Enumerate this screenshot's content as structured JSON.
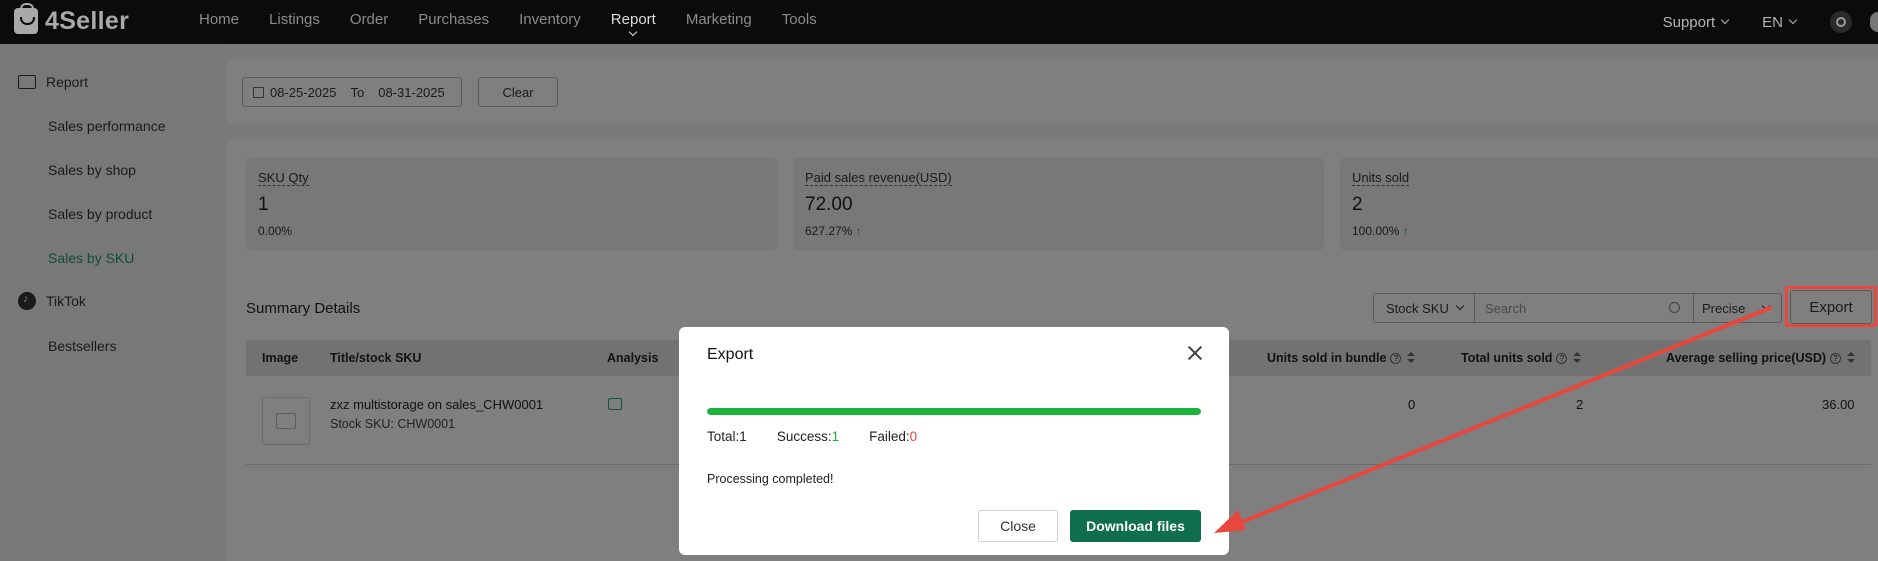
{
  "brand": "4Seller",
  "nav": {
    "items": [
      "Home",
      "Listings",
      "Order",
      "Purchases",
      "Inventory",
      "Report",
      "Marketing",
      "Tools"
    ],
    "active": "Report",
    "support": "Support",
    "language": "EN"
  },
  "sidebar": {
    "report_group": "Report",
    "items": [
      "Sales performance",
      "Sales by shop",
      "Sales by product",
      "Sales by SKU"
    ],
    "active": "Sales by SKU",
    "tiktok_group": "TikTok",
    "bestsellers": "Bestsellers"
  },
  "filter": {
    "date_from": "08-25-2025",
    "to_label": "To",
    "date_to": "08-31-2025",
    "clear_label": "Clear"
  },
  "cards": [
    {
      "label": "SKU Qty",
      "value": "1",
      "change": "0.00%",
      "trend": ""
    },
    {
      "label": "Paid sales revenue(USD)",
      "value": "72.00",
      "change": "627.27%",
      "trend": "↑"
    },
    {
      "label": "Units sold",
      "value": "2",
      "change": "100.00%",
      "trend": "↑"
    }
  ],
  "summary": {
    "title": "Summary Details",
    "sku_type": "Stock SKU",
    "search_placeholder": "Search",
    "match_mode": "Precise",
    "export_label": "Export"
  },
  "table": {
    "headers": {
      "image": "Image",
      "title": "Title/stock SKU",
      "analysis": "Analysis",
      "units_bundle": "Units sold in bundle",
      "total_units": "Total units sold",
      "avg_price": "Average selling price(USD)"
    },
    "rows": [
      {
        "title": "zxz multistorage on sales_CHW0001",
        "stock_sku": "Stock SKU: CHW0001",
        "units_bundle": "0",
        "total_units": "2",
        "avg_price": "36.00"
      }
    ]
  },
  "modal": {
    "title": "Export",
    "progress": 1.0,
    "total_label": "Total",
    "total_value": "1",
    "success_label": "Success",
    "success_value": "1",
    "failed_label": "Failed",
    "failed_value": "0",
    "message": "Processing completed!",
    "close_label": "Close",
    "download_label": "Download files"
  },
  "colors": {
    "accent": "#0e6e4e",
    "success": "#1bb33b",
    "failed": "#e8473d",
    "annotation": "#e8473d"
  }
}
